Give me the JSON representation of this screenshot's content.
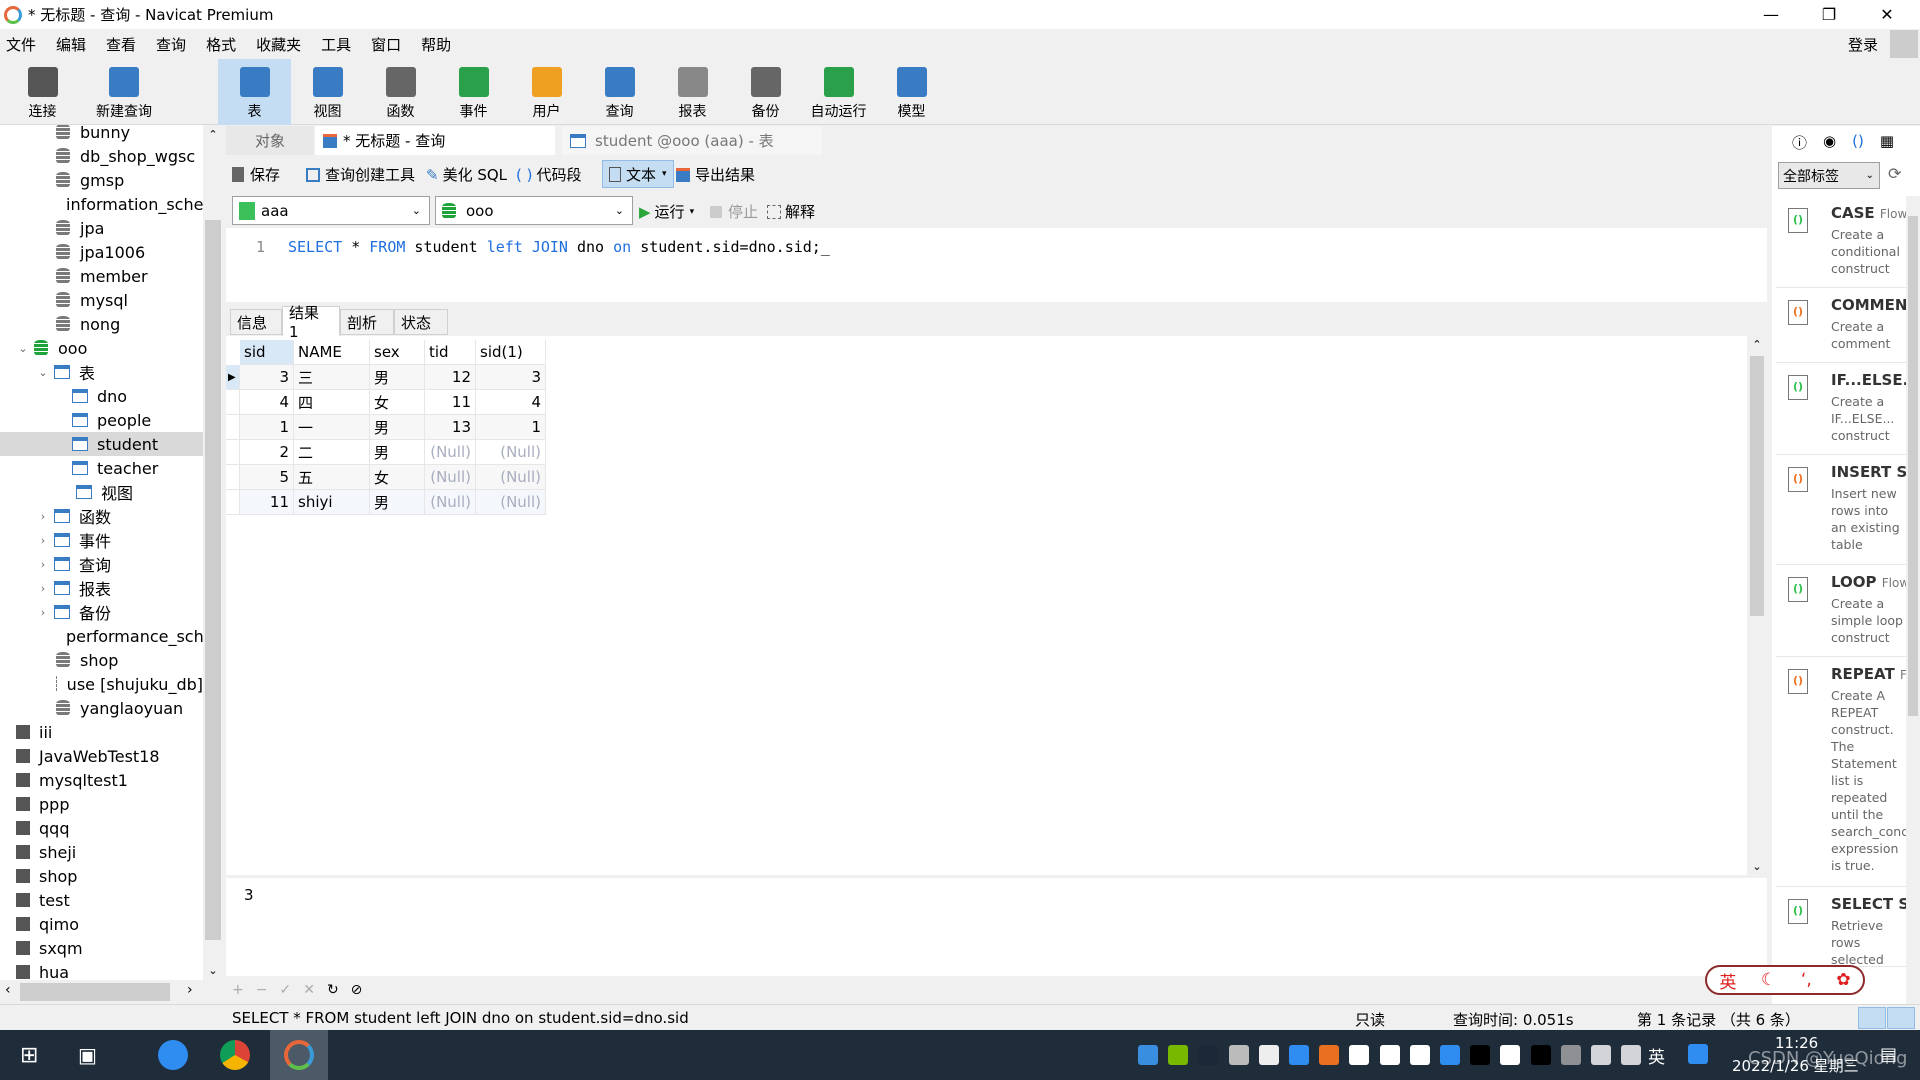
{
  "window": {
    "title": "* 无标题 - 查询 - Navicat Premium"
  },
  "menu": [
    "文件",
    "编辑",
    "查看",
    "查询",
    "格式",
    "收藏夹",
    "工具",
    "窗口",
    "帮助"
  ],
  "user": {
    "login": "登录"
  },
  "toolbar": [
    {
      "label": "连接",
      "icon": "plug-icon",
      "color": "#555555"
    },
    {
      "label": "新建查询",
      "icon": "new-query-icon",
      "color": "#3a7cc4"
    },
    {
      "label": "表",
      "icon": "table-icon",
      "color": "#3a7cc4",
      "active": true
    },
    {
      "label": "视图",
      "icon": "view-icon",
      "color": "#3a7cc4"
    },
    {
      "label": "函数",
      "icon": "function-icon",
      "color": "#666666"
    },
    {
      "label": "事件",
      "icon": "clock-icon",
      "color": "#2aa04a"
    },
    {
      "label": "用户",
      "icon": "user-icon",
      "color": "#f0a020"
    },
    {
      "label": "查询",
      "icon": "query-icon",
      "color": "#3a7cc4"
    },
    {
      "label": "报表",
      "icon": "report-icon",
      "color": "#888888"
    },
    {
      "label": "备份",
      "icon": "backup-icon",
      "color": "#666666"
    },
    {
      "label": "自动运行",
      "icon": "schedule-icon",
      "color": "#2aa04a"
    },
    {
      "label": "模型",
      "icon": "model-icon",
      "color": "#3a7cc4"
    }
  ],
  "tree": [
    {
      "label": "bunny",
      "type": "db",
      "level": 1
    },
    {
      "label": "db_shop_wgsc",
      "type": "db",
      "level": 1
    },
    {
      "label": "gmsp",
      "type": "db",
      "level": 1
    },
    {
      "label": "information_schema",
      "type": "db",
      "level": 1
    },
    {
      "label": "jpa",
      "type": "db",
      "level": 1
    },
    {
      "label": "jpa1006",
      "type": "db",
      "level": 1
    },
    {
      "label": "member",
      "type": "db",
      "level": 1
    },
    {
      "label": "mysql",
      "type": "db",
      "level": 1
    },
    {
      "label": "nong",
      "type": "db",
      "level": 1
    },
    {
      "label": "ooo",
      "type": "dbopen",
      "level": 1,
      "arrow": "v"
    },
    {
      "label": "表",
      "type": "tables",
      "level": 2,
      "arrow": "v"
    },
    {
      "label": "dno",
      "type": "table",
      "level": 3
    },
    {
      "label": "people",
      "type": "table",
      "level": 3
    },
    {
      "label": "student",
      "type": "table",
      "level": 3,
      "selected": true
    },
    {
      "label": "teacher",
      "type": "table",
      "level": 3
    },
    {
      "label": "视图",
      "type": "views",
      "level": 2
    },
    {
      "label": "函数",
      "type": "func",
      "level": 2,
      "arrow": ">"
    },
    {
      "label": "事件",
      "type": "event",
      "level": 2,
      "arrow": ">"
    },
    {
      "label": "查询",
      "type": "query",
      "level": 2,
      "arrow": ">"
    },
    {
      "label": "报表",
      "type": "report",
      "level": 2,
      "arrow": ">"
    },
    {
      "label": "备份",
      "type": "backup",
      "level": 2,
      "arrow": ">"
    },
    {
      "label": "performance_schema",
      "type": "db",
      "level": 1
    },
    {
      "label": "shop",
      "type": "db",
      "level": 1
    },
    {
      "label": "use [shujuku_db]",
      "type": "db",
      "level": 1
    },
    {
      "label": "yanglaoyuan",
      "type": "db",
      "level": 1
    },
    {
      "label": "iii",
      "type": "conn",
      "level": 0
    },
    {
      "label": "JavaWebTest18",
      "type": "conn",
      "level": 0
    },
    {
      "label": "mysqltest1",
      "type": "conn",
      "level": 0
    },
    {
      "label": "ppp",
      "type": "conn",
      "level": 0
    },
    {
      "label": "qqq",
      "type": "conn",
      "level": 0
    },
    {
      "label": "sheji",
      "type": "conn",
      "level": 0
    },
    {
      "label": "shop",
      "type": "conn",
      "level": 0
    },
    {
      "label": "test",
      "type": "conn",
      "level": 0
    },
    {
      "label": "qimo",
      "type": "conn",
      "level": 0
    },
    {
      "label": "sxqm",
      "type": "conn",
      "level": 0
    },
    {
      "label": "hua",
      "type": "conn",
      "level": 0
    }
  ],
  "tabs": [
    {
      "label": "对象"
    },
    {
      "label": "* 无标题 - 查询",
      "active": true
    },
    {
      "label": "student @ooo (aaa) - 表"
    }
  ],
  "query_toolbar": {
    "save": "保存",
    "builder": "查询创建工具",
    "beautify": "美化 SQL",
    "snippet": "代码段",
    "text": "文本",
    "export": "导出结果",
    "run": "运行",
    "stop": "停止",
    "explain": "解释"
  },
  "connection": {
    "selected": "aaa"
  },
  "database": {
    "selected": "ooo"
  },
  "editor": {
    "line": "1",
    "tokens": [
      [
        "SELECT",
        "kw"
      ],
      [
        " * ",
        ""
      ],
      [
        "FROM",
        "kw"
      ],
      [
        " student ",
        ""
      ],
      [
        "left",
        "kw"
      ],
      [
        " ",
        ""
      ],
      [
        "JOIN",
        "kw"
      ],
      [
        " dno ",
        ""
      ],
      [
        "on",
        "kw"
      ],
      [
        " student.sid=dno.sid;",
        ""
      ]
    ]
  },
  "result_tabs": [
    "信息",
    "结果 1",
    "剖析",
    "状态"
  ],
  "grid": {
    "columns": [
      "sid",
      "NAME",
      "sex",
      "tid",
      "sid(1)"
    ],
    "rows": [
      [
        "3",
        "三",
        "男",
        "12",
        "3"
      ],
      [
        "4",
        "四",
        "女",
        "11",
        "4"
      ],
      [
        "1",
        "一",
        "男",
        "13",
        "1"
      ],
      [
        "2",
        "二",
        "男",
        "(Null)",
        "(Null)"
      ],
      [
        "5",
        "五",
        "女",
        "(Null)",
        "(Null)"
      ],
      [
        "11",
        "shiyi",
        "男",
        "(Null)",
        "(Null)"
      ]
    ]
  },
  "detail_value": "3",
  "right_panel": {
    "filter": "全部标签",
    "snippets": [
      {
        "name": "CASE",
        "tag": "Flow",
        "desc": "Create a conditional construct"
      },
      {
        "name": "COMMENT",
        "tag": "",
        "desc": "Create a comment"
      },
      {
        "name": "IF...ELSE...",
        "tag": "",
        "desc": "Create a IF...ELSE... construct"
      },
      {
        "name": "INSERT Sy",
        "tag": "",
        "desc": "Insert new rows into an existing table"
      },
      {
        "name": "LOOP",
        "tag": "Flow",
        "desc": "Create a simple loop construct"
      },
      {
        "name": "REPEAT",
        "tag": "Fl",
        "desc": "Create A REPEAT construct. The Statement list is repeated until the search_cond expression is true."
      },
      {
        "name": "SELECT Sy",
        "tag": "",
        "desc": "Retrieve rows selected"
      }
    ]
  },
  "ime": {
    "lang": "英"
  },
  "status": {
    "sql": "SELECT * FROM student left JOIN dno on student.sid=dno.sid",
    "mode": "只读",
    "time": "查询时间: 0.051s",
    "record": "第 1 条记录 （共 6 条）"
  },
  "taskbar": {
    "time": "11:26",
    "date": "2022/1/26 星期三",
    "ime": "英",
    "watermark": "CSDN @YueQiong"
  }
}
